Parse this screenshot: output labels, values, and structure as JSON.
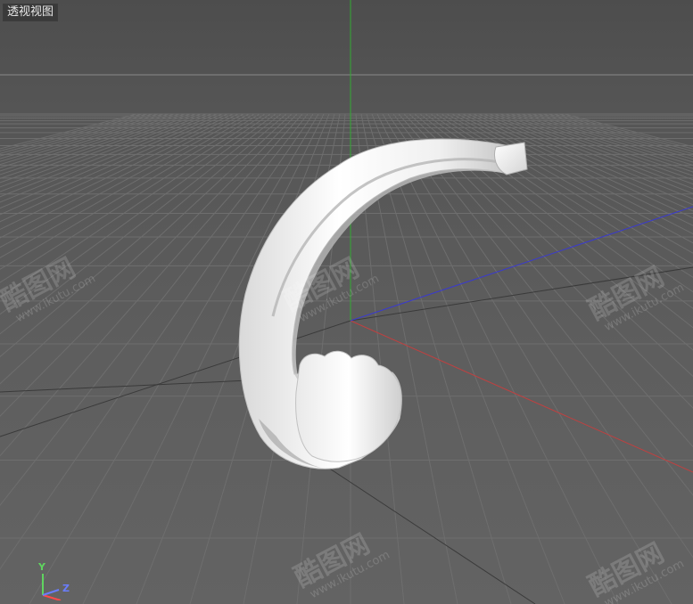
{
  "viewport": {
    "label": "透视视图"
  },
  "gizmo": {
    "y_label": "Y",
    "z_label": "Z",
    "y_color": "#5fd35f",
    "x_color": "#ff4a4a",
    "z_color": "#6a7dff"
  },
  "axes_colors": {
    "x_axis": "#c04040",
    "y_axis": "#33aa33",
    "z_axis": "#3a3ad0"
  },
  "watermarks": [
    {
      "text": "酷图网",
      "url": "www.ikutu.com"
    },
    {
      "text": "酷图网",
      "url": "www.ikutu.com"
    },
    {
      "text": "酷图网",
      "url": "www.ikutu.com"
    },
    {
      "text": "酷图网",
      "url": "www.ikutu.com"
    },
    {
      "text": "酷图网",
      "url": "www.ikutu.com"
    }
  ],
  "object": {
    "name": "curved-claw-model",
    "color": "#f2f2f2"
  }
}
